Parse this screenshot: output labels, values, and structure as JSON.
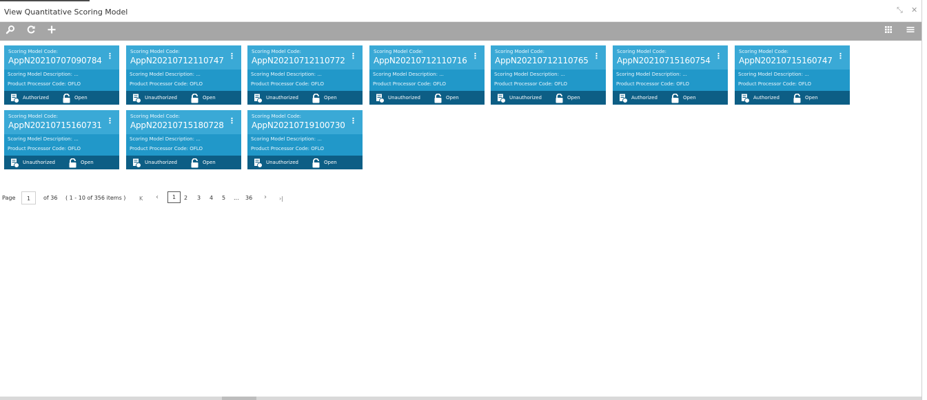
{
  "window": {
    "title": "View Quantitative Scoring Model",
    "minimize_glyph": "⤡",
    "close_glyph": "✕"
  },
  "toolbar": {
    "search_icon": "search-icon",
    "refresh_icon": "refresh-icon",
    "add_icon": "add-icon",
    "grid_view_icon": "grid-view-icon",
    "list_view_icon": "list-view-icon"
  },
  "labels": {
    "code_label": "Scoring Model Code:",
    "desc_label": "Scoring Model Description: ...",
    "ppc_label": "Product Processor Code:",
    "open_label": "Open"
  },
  "cards": [
    {
      "code": "AppN20210707090784",
      "ppc": "OFLO",
      "status": "Authorized",
      "lock": "Open"
    },
    {
      "code": "AppN20210712110747",
      "ppc": "OFLO",
      "status": "Unauthorized",
      "lock": "Open"
    },
    {
      "code": "AppN20210712110772",
      "ppc": "OFLO",
      "status": "Unauthorized",
      "lock": "Open"
    },
    {
      "code": "AppN20210712110716",
      "ppc": "OFLO",
      "status": "Unauthorized",
      "lock": "Open"
    },
    {
      "code": "AppN20210712110765",
      "ppc": "OFLO",
      "status": "Unauthorized",
      "lock": "Open"
    },
    {
      "code": "AppN20210715160754",
      "ppc": "OFLO",
      "status": "Authorized",
      "lock": "Open"
    },
    {
      "code": "AppN20210715160747",
      "ppc": "OFLO",
      "status": "Authorized",
      "lock": "Open"
    },
    {
      "code": "AppN20210715160731",
      "ppc": "OFLO",
      "status": "Unauthorized",
      "lock": "Open"
    },
    {
      "code": "AppN20210715180728",
      "ppc": "OFLO",
      "status": "Unauthorized",
      "lock": "Open"
    },
    {
      "code": "AppN20210719100730",
      "ppc": "OFLO",
      "status": "Unauthorized",
      "lock": "Open"
    }
  ],
  "pagination": {
    "page_label": "Page",
    "current_page": "1",
    "of_label": "of 36",
    "items_label": "( 1 - 10 of 356 items )",
    "first_glyph": "K",
    "prev_glyph": "‹",
    "pages": [
      "1",
      "2",
      "3",
      "4",
      "5",
      "...",
      "36"
    ],
    "next_glyph": "›",
    "last_glyph": "›|"
  },
  "colors": {
    "card_head": "#3aa9d6",
    "card_body": "#2198c9",
    "card_footer": "#0d5e85",
    "toolbar": "#a6a6a6"
  }
}
